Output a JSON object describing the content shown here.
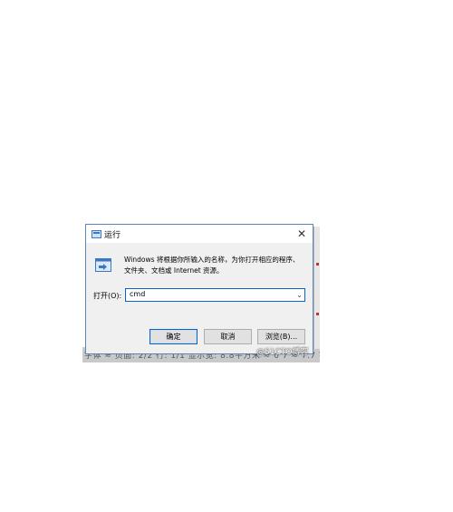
{
  "dialog": {
    "title": "运行",
    "close_glyph": "✕",
    "message": "Windows 将根据你所输入的名称，为你打开相应的程序、文件夹、文档或 Internet 资源。",
    "open_label": "打开(O):",
    "open_value": "cmd",
    "dropdown_glyph": "⌄",
    "buttons": {
      "ok": "确定",
      "cancel": "取消",
      "browse": "浏览(B)..."
    }
  },
  "background": {
    "garbled_text": "字体 ≈  页面: 2/2   行: 1/1   显示宽: 8.8平方米   ≈ 0 7 ≈  7.7  字数 144"
  },
  "watermark": "@51CTO博客",
  "colors": {
    "accent": "#0a64c8",
    "dialog_border": "#5b86b8",
    "dialog_bg": "#f0f0f0"
  }
}
